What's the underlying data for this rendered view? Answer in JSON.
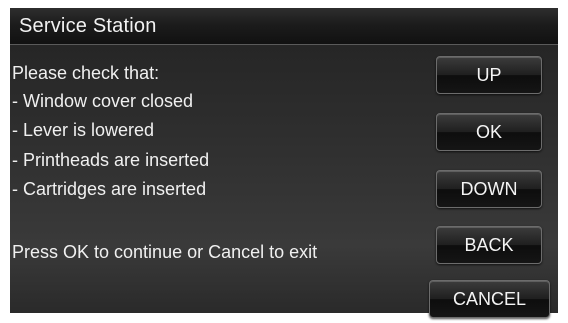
{
  "title": "Service Station",
  "message": {
    "heading": "Please check that:",
    "items": [
      " - Window cover closed",
      " - Lever is lowered",
      " - Printheads are inserted",
      " - Cartridges are inserted"
    ],
    "footer": "Press OK to continue or Cancel to exit"
  },
  "buttons": {
    "up": "UP",
    "ok": "OK",
    "down": "DOWN",
    "back": "BACK",
    "cancel": "CANCEL"
  }
}
